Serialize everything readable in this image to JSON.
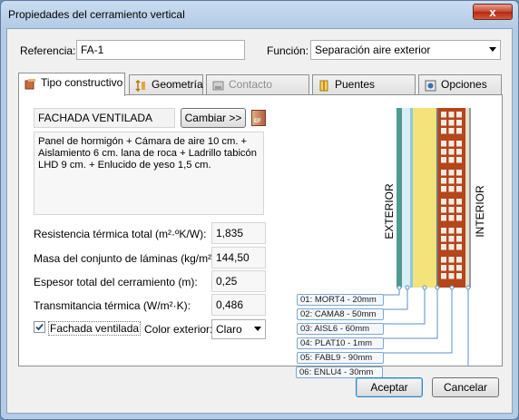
{
  "window": {
    "title": "Propiedades del cerramiento vertical",
    "close_glyph": "x"
  },
  "form": {
    "referencia_label": "Referencia:",
    "referencia_value": "FA-1",
    "funcion_label": "Función:",
    "funcion_value": "Separación aire exterior"
  },
  "tabs": [
    {
      "label": "Tipo constructivo",
      "icon": "construction-type-icon",
      "active": true
    },
    {
      "label": "Geometría",
      "icon": "geometry-icon",
      "active": false
    },
    {
      "label": "Contacto terreno",
      "icon": "ground-contact-icon",
      "active": false,
      "disabled": true
    },
    {
      "label": "Puentes térmicos",
      "icon": "thermal-bridge-icon",
      "active": false
    },
    {
      "label": "Opciones HR",
      "icon": "hr-options-icon",
      "active": false
    }
  ],
  "construction": {
    "name": "FACHADA VENTILADA",
    "change_button": "Cambiar >>",
    "description": "Panel de hormigón + Cámara de aire 10 cm. + Aislamiento 6 cm. lana de roca + Ladrillo tabicón LHD 9 cm. + Enlucido de yeso 1,5 cm."
  },
  "properties": [
    {
      "label": "Resistencia térmica total  (m²·ºK/W):",
      "value": "1,835"
    },
    {
      "label": "Masa del conjunto de láminas (kg/m²):",
      "value": "144,50"
    },
    {
      "label": "Espesor total del cerramiento (m):",
      "value": "0,25"
    },
    {
      "label": "Transmitancia térmica (W/m²·K):",
      "value": "0,486"
    }
  ],
  "fachada_ventilada": {
    "label": "Fachada ventilada",
    "checked": true
  },
  "color_exterior": {
    "label": "Color exterior:",
    "value": "Claro"
  },
  "diagram": {
    "exterior_label": "EXTERIOR",
    "interior_label": "INTERIOR",
    "layers": [
      "01: MORT4 - 20mm",
      "02: CAMA8 - 50mm",
      "03: AISL6 - 60mm",
      "04: PLAT10 - 1mm",
      "05: FABL9 - 90mm",
      "06: ENLU4 - 30mm"
    ]
  },
  "footer": {
    "accept": "Aceptar",
    "cancel": "Cancelar"
  },
  "colors": {
    "title_gradient_top": "#c9dcf0",
    "brick": "#b5451b",
    "insulation": "#f4e27a",
    "mortar": "#c0c0c0",
    "concrete": "#4f9a8e",
    "label_border": "#7fa7d0",
    "default_button_border": "#3c7fb1"
  }
}
